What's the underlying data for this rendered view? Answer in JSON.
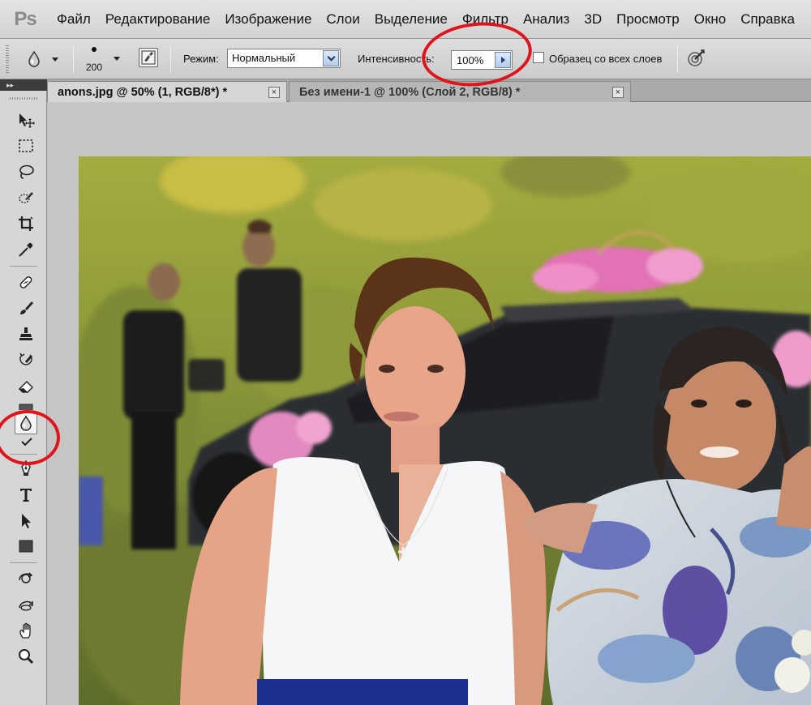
{
  "app": {
    "logo": "Ps"
  },
  "menu": [
    "Файл",
    "Редактирование",
    "Изображение",
    "Слои",
    "Выделение",
    "Фильтр",
    "Анализ",
    "3D",
    "Просмотр",
    "Окно",
    "Справка"
  ],
  "options": {
    "brush_size": "200",
    "mode_label": "Режим:",
    "mode_value": "Нормальный",
    "strength_label": "Интенсивность:",
    "strength_value": "100%",
    "sample_all_layers_label": "Образец со всех слоев",
    "sample_all_layers_checked": false
  },
  "tabs": [
    {
      "label": "anons.jpg @ 50% (1, RGB/8*) *",
      "active": true
    },
    {
      "label": "Без имени-1 @ 100% (Слой 2, RGB/8) *",
      "active": false
    }
  ],
  "tools": [
    "move-icon",
    "marquee-icon",
    "lasso-icon",
    "quick-selection-icon",
    "crop-icon",
    "eyedropper-icon",
    "healing-brush-icon",
    "brush-icon",
    "clone-stamp-icon",
    "history-brush-icon",
    "eraser-icon",
    "gradient-icon",
    "blur-icon",
    "dodge-icon",
    "pen-icon",
    "type-icon",
    "path-selection-icon",
    "rectangle-icon",
    "3d-rotate-icon",
    "3d-orbit-icon",
    "hand-icon",
    "zoom-icon"
  ],
  "selected_tool": "blur-icon",
  "colors": {
    "annotation": "#e0141b",
    "chrome": "#d6d6d6",
    "canvas": "#c5c5c5"
  }
}
